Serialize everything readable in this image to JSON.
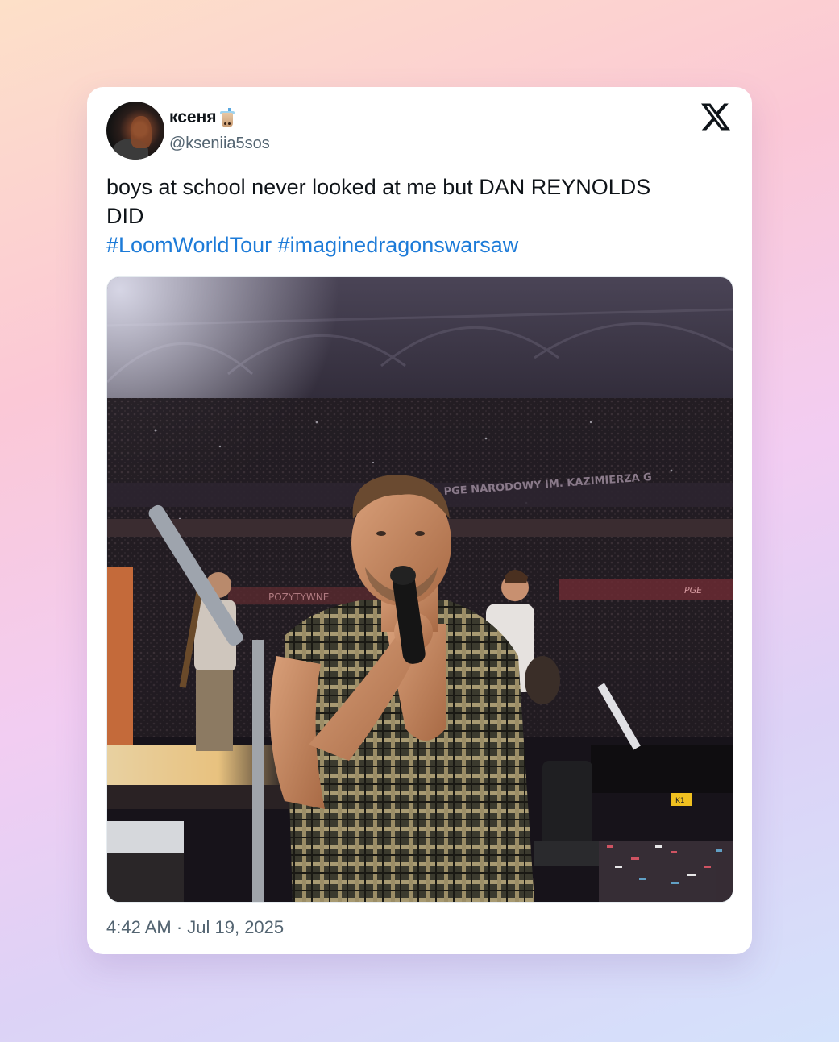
{
  "tweet": {
    "author_name": "ксеня",
    "author_emoji": "bubble-tea-icon",
    "author_handle": "@kseniia5sos",
    "text_line1": "boys at school never looked at me but DAN REYNOLDS",
    "text_line2": "DID",
    "hashtags": [
      "#LoomWorldTour",
      "#imaginedragonswarsaw"
    ],
    "timestamp": "4:42 AM · Jul 19, 2025"
  },
  "photo_signage": {
    "stadium_banner": "PGE NARODOWY IM. KAZIMIERZA G",
    "banner_left": "POZYTYWNE",
    "sponsor": "PGE",
    "case_label": "K1"
  },
  "colors": {
    "hashtag": "#1d7bd8",
    "handle": "#536471",
    "text": "#0f1419"
  }
}
